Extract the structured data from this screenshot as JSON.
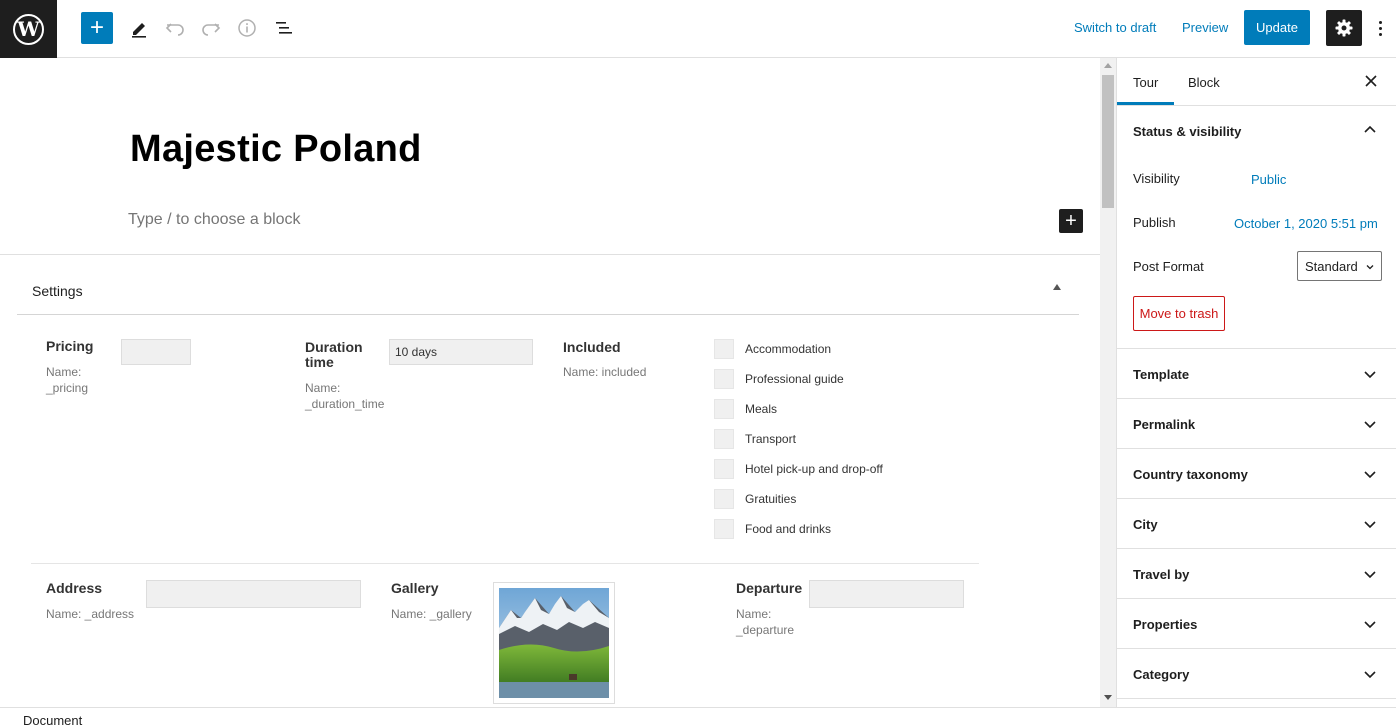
{
  "toolbar": {
    "switch_to_draft": "Switch to draft",
    "preview": "Preview",
    "update": "Update",
    "accent_color": "#007cba"
  },
  "post": {
    "title": "Majestic Poland",
    "placeholder": "Type / to choose a block"
  },
  "meta_box": {
    "title": "Settings",
    "fields": {
      "pricing": {
        "label": "Pricing",
        "name": "Name: _pricing",
        "value": ""
      },
      "duration": {
        "label": "Duration time",
        "name": "Name: _duration_time",
        "value": "10 days"
      },
      "included": {
        "label": "Included",
        "name": "Name: included",
        "options": [
          "Accommodation",
          "Professional guide",
          "Meals",
          "Transport",
          "Hotel pick-up and drop-off",
          "Gratuities",
          "Food and drinks"
        ]
      },
      "address": {
        "label": "Address",
        "name": "Name: _address",
        "value": ""
      },
      "gallery": {
        "label": "Gallery",
        "name": "Name: _gallery"
      },
      "departure": {
        "label": "Departure",
        "name": "Name: _departure",
        "value": ""
      }
    }
  },
  "sidebar": {
    "tabs": [
      "Tour",
      "Block"
    ],
    "status": {
      "title": "Status & visibility",
      "visibility_label": "Visibility",
      "visibility_value": "Public",
      "publish_label": "Publish",
      "publish_value": "October 1, 2020 5:51 pm",
      "format_label": "Post Format",
      "format_value": "Standard",
      "trash": "Move to trash"
    },
    "panels": [
      "Template",
      "Permalink",
      "Country taxonomy",
      "City",
      "Travel by",
      "Properties",
      "Category"
    ]
  },
  "footer": {
    "breadcrumb": "Document"
  }
}
